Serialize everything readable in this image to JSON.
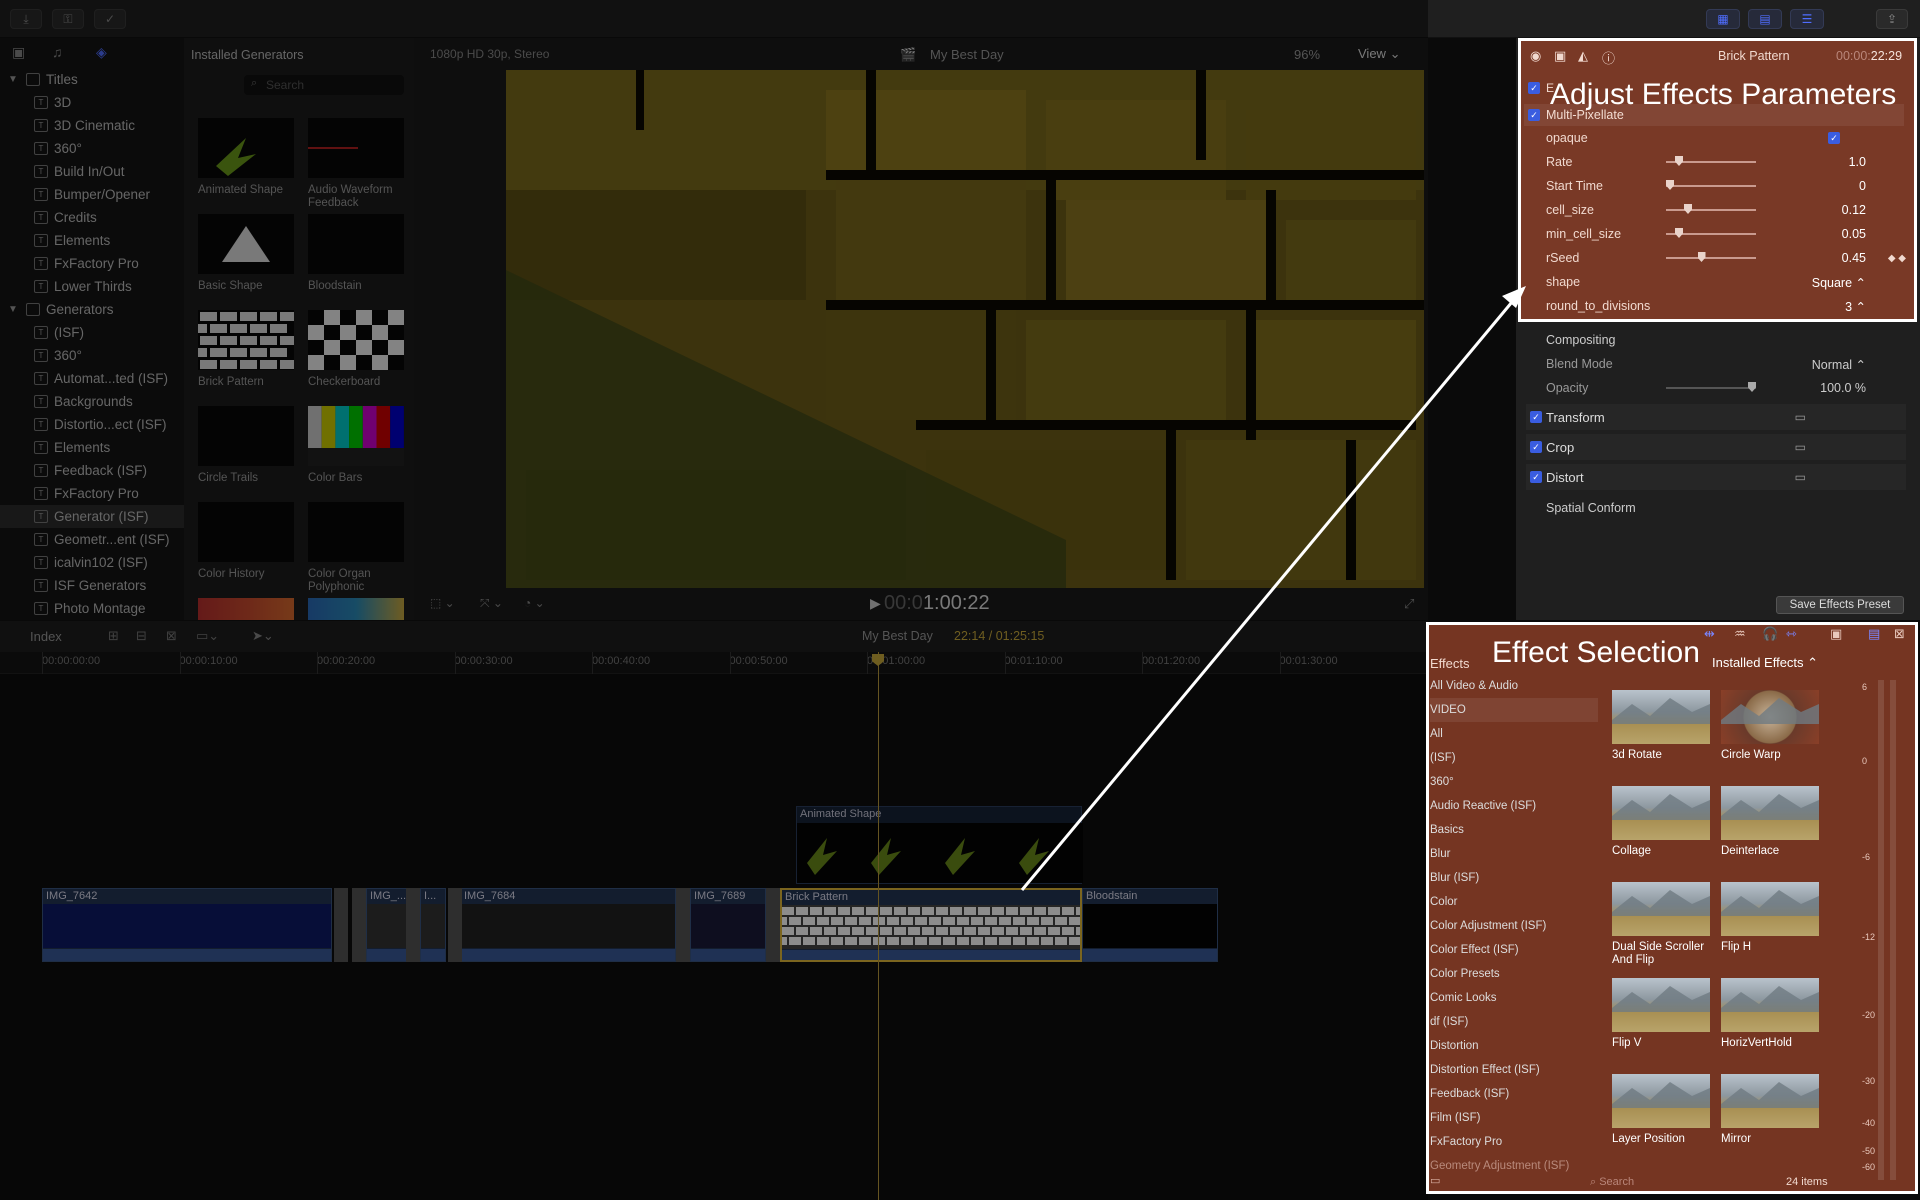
{
  "library": {
    "titles_header": "Titles",
    "titles": [
      "3D",
      "3D Cinematic",
      "360°",
      "Build In/Out",
      "Bumper/Opener",
      "Credits",
      "Elements",
      "FxFactory Pro",
      "Lower Thirds"
    ],
    "generators_header": "Generators",
    "generators": [
      "(ISF)",
      "360°",
      "Automat...ted (ISF)",
      "Backgrounds",
      "Distortio...ect (ISF)",
      "Elements",
      "Feedback (ISF)",
      "FxFactory Pro",
      "Generator (ISF)",
      "Geometr...ent (ISF)",
      "icalvin102 (ISF)",
      "ISF Generators",
      "Photo Montage"
    ],
    "selected_generator": "Generator (ISF)"
  },
  "browser": {
    "header": "Installed Generators",
    "search_placeholder": "Search",
    "items": [
      "Animated Shape",
      "Audio Waveform Feedback",
      "Basic Shape",
      "Bloodstain",
      "Brick Pattern",
      "Checkerboard",
      "Circle Trails",
      "Color Bars",
      "Color History",
      "Color Organ Polyphonic"
    ]
  },
  "viewer": {
    "format": "1080p HD 30p, Stereo",
    "project": "My Best Day",
    "zoom": "96%",
    "view_label": "View",
    "timecode_dim": "00:0",
    "timecode": "1:00:22"
  },
  "timeline": {
    "index_label": "Index",
    "project": "My Best Day",
    "position": "22:14 / 01:25:15",
    "ticks": [
      "00:00:00:00",
      "00:00:10:00",
      "00:00:20:00",
      "00:00:30:00",
      "00:00:40:00",
      "00:00:50:00",
      "00:01:00:00",
      "00:01:10:00",
      "00:01:20:00",
      "00:01:30:00"
    ],
    "connected_clip": "Animated Shape",
    "clips": [
      "IMG_7642",
      "IMG_...",
      "I...",
      "IMG_7684",
      "IMG_7689",
      "Brick Pattern",
      "Bloodstain"
    ]
  },
  "inspector": {
    "title": "Brick Pattern",
    "duration_dim": "00:00:",
    "duration": "22:29",
    "effect_cut": "E",
    "effect_name": "Multi-Pixellate",
    "params": [
      {
        "name": "opaque",
        "value": ""
      },
      {
        "name": "Rate",
        "value": "1.0"
      },
      {
        "name": "Start Time",
        "value": "0"
      },
      {
        "name": "cell_size",
        "value": "0.12"
      },
      {
        "name": "min_cell_size",
        "value": "0.05"
      },
      {
        "name": "rSeed",
        "value": "0.45"
      },
      {
        "name": "shape",
        "value": "Square ⌃"
      },
      {
        "name": "round_to_divisions",
        "value": "3 ⌃"
      }
    ],
    "compositing": "Compositing",
    "blend_mode_label": "Blend Mode",
    "blend_mode_value": "Normal ⌃",
    "opacity_label": "Opacity",
    "opacity_value": "100.0 %",
    "sections": [
      "Transform",
      "Crop",
      "Distort"
    ],
    "spatial_conform": "Spatial Conform",
    "save_preset": "Save Effects Preset"
  },
  "effects": {
    "header": "Effects",
    "installed": "Installed Effects ⌃",
    "categories": [
      "All Video & Audio",
      "VIDEO",
      "All",
      "(ISF)",
      "360°",
      "Audio Reactive (ISF)",
      "Basics",
      "Blur",
      "Blur (ISF)",
      "Color",
      "Color Adjustment (ISF)",
      "Color Effect (ISF)",
      "Color Presets",
      "Comic Looks",
      "df (ISF)",
      "Distortion",
      "Distortion Effect (ISF)",
      "Feedback (ISF)",
      "Film (ISF)",
      "FxFactory Pro",
      "Geometry Adjustment (ISF)"
    ],
    "items": [
      "3d Rotate",
      "Circle Warp",
      "Collage",
      "Deinterlace",
      "Dual Side Scroller And Flip",
      "Flip H",
      "Flip V",
      "HorizVertHold",
      "Layer Position",
      "Mirror"
    ],
    "search_placeholder": "Search",
    "count": "24 items",
    "meter_labels": [
      "6",
      "0",
      "-6",
      "-12",
      "-20",
      "-30",
      "-40",
      "-50",
      "-60"
    ]
  },
  "annotations": {
    "adjust": "Adjust Effects Parameters",
    "selection": "Effect Selection"
  }
}
